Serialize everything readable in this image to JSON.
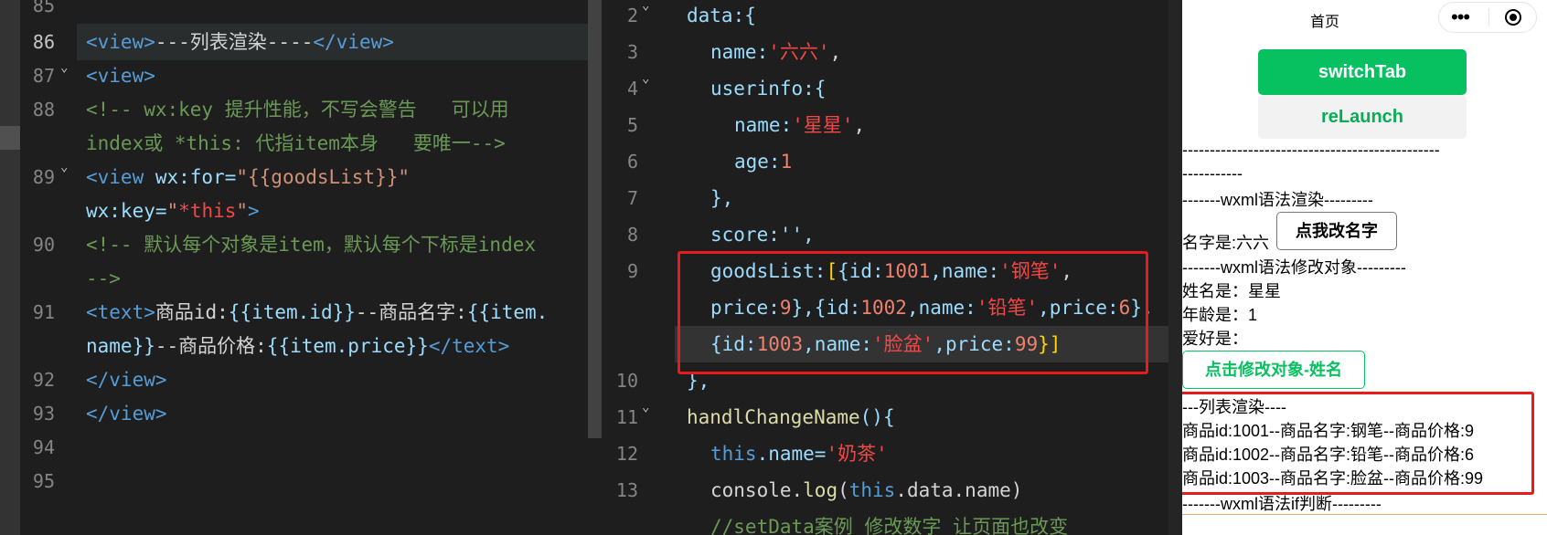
{
  "left_editor": {
    "line_numbers": [
      "85",
      "86",
      "87",
      "88",
      "",
      "89",
      "",
      "90",
      "",
      "91",
      "",
      "92",
      "93",
      "94",
      "95"
    ],
    "lines": {
      "l86": {
        "open": "<view>",
        "text": "---列表渲染----",
        "close": "</view>"
      },
      "l87": {
        "open": "<view>"
      },
      "l88a": "<!-- wx:key 提升性能，不写会警告   可以用",
      "l88b": "index或 *this: 代指item本身   要唯一-->",
      "l89a_open": "<view",
      "l89a_attr": " wx:for=",
      "l89a_val": "\"{{goodsList}}\"",
      "l89b_attr": "wx:key=",
      "l89b_q1": "\"",
      "l89b_val": "*this",
      "l89b_q2": "\"",
      "l89b_close": ">",
      "l90a": "<!-- 默认每个对象是item，默认每个下标是index",
      "l90b": "-->",
      "l91a_open": "<text>",
      "l91a_txt": "商品id:",
      "l91a_expr": "{{item.id}}",
      "l91a_txt2": "--商品名字:",
      "l91a_expr2": "{{item.",
      "l91b_expr": "name}}",
      "l91b_txt": "--商品价格:",
      "l91b_expr2": "{{item.price}}",
      "l91b_close": "</text>",
      "l92": "</view>",
      "l93": "</view>"
    }
  },
  "right_editor": {
    "line_numbers": [
      "2",
      "3",
      "4",
      "5",
      "6",
      "7",
      "8",
      "9",
      "",
      "",
      "10",
      "11",
      "12",
      "13"
    ],
    "lines": {
      "l2": "data:{",
      "l3_key": "name:",
      "l3_str": "'六六'",
      "l3_end": ",",
      "l4": "userinfo:{",
      "l5_key": "name:",
      "l5_str": "'星星'",
      "l5_end": ",",
      "l6_key": "age:",
      "l6_num": "1",
      "l7": "},",
      "l8": "score:'',",
      "l9a": {
        "k": "goodsList:",
        "b1": "[",
        "b2": "{",
        "id": "id:",
        "n1": "1001",
        "name": ",name:",
        "s1": "'钢笔'",
        "end": ","
      },
      "l9b": {
        "k": "price:",
        "n": "9",
        "mid": "},{id:",
        "n2": "1002",
        "name": ",name:",
        "s": "'铅笔'",
        "pk": ",price:",
        "n3": "6",
        "end": "},"
      },
      "l9c": {
        "open": "{id:",
        "n": "1003",
        "name": ",name:",
        "s": "'脸盆'",
        "pk": ",price:",
        "n2": "99",
        "end": "}]"
      },
      "l10": "},",
      "l11_fn": "handlChangeName",
      "l11_rest": "(){",
      "l12_this": "this",
      "l12_mid": ".name=",
      "l12_str": "'奶茶'",
      "l13_a": "console.",
      "l13_fn": "log",
      "l13_b": "(",
      "l13_this": "this",
      "l13_c": ".data.name)",
      "l14": "//setData案例 修改数字 让页面也改变"
    }
  },
  "simulator": {
    "nav_title": "首页",
    "btn_switchtab": "switchTab",
    "btn_relaunch": "reLaunch",
    "dash_line1": "-----------------------------------------------",
    "dash_line2": "-----------",
    "section_render": "-------wxml语法渲染---------",
    "name_label": "名字是:六六",
    "btn_change_name": "点我改名字",
    "section_modify": "-------wxml语法修改对象---------",
    "fullname": "姓名是：星星",
    "age": "年龄是：1",
    "hobby": "爱好是：",
    "btn_modify_obj": "点击修改对象-姓名",
    "list_title": "---列表渲染----",
    "items": [
      "商品id:1001--商品名字:钢笔--商品价格:9",
      "商品id:1002--商品名字:铅笔--商品价格:6",
      "商品id:1003--商品名字:脸盆--商品价格:99"
    ],
    "section_if": "-------wxml语法if判断---------"
  },
  "colors": {
    "switchtab_bg": "#07c160",
    "relaunch_bg": "#f2f2f2",
    "relaunch_fg": "#06ae56",
    "highlight_box": "#e81b1b"
  }
}
